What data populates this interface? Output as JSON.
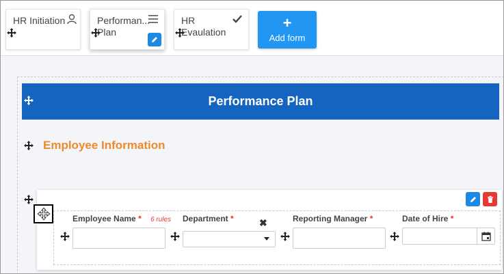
{
  "tabs": [
    {
      "title": "HR Initiation",
      "right_icon": "user-icon",
      "active": false
    },
    {
      "title": "Performan... Plan",
      "right_icon": "menu-icon",
      "active": true
    },
    {
      "title": "HR Evaulation",
      "right_icon": "check-icon",
      "active": false
    }
  ],
  "add_form": {
    "plus": "+",
    "label": "Add form"
  },
  "banner": {
    "title": "Performance Plan",
    "color": "#1565c0"
  },
  "subsection": {
    "title": "Employee Information",
    "color": "#ef8a2c"
  },
  "fields": [
    {
      "label": "Employee Name",
      "required": "*",
      "rules": "6 rules",
      "type": "text",
      "value": ""
    },
    {
      "label": "Department",
      "required": "*",
      "type": "select",
      "value": "",
      "clear": "✖"
    },
    {
      "label": "Reporting Manager",
      "required": "*",
      "type": "text",
      "value": ""
    },
    {
      "label": "Date of Hire",
      "required": "*",
      "type": "date",
      "value": ""
    }
  ],
  "colors": {
    "accent": "#2196f3",
    "edit": "#1e88e5",
    "delete": "#e53935"
  }
}
